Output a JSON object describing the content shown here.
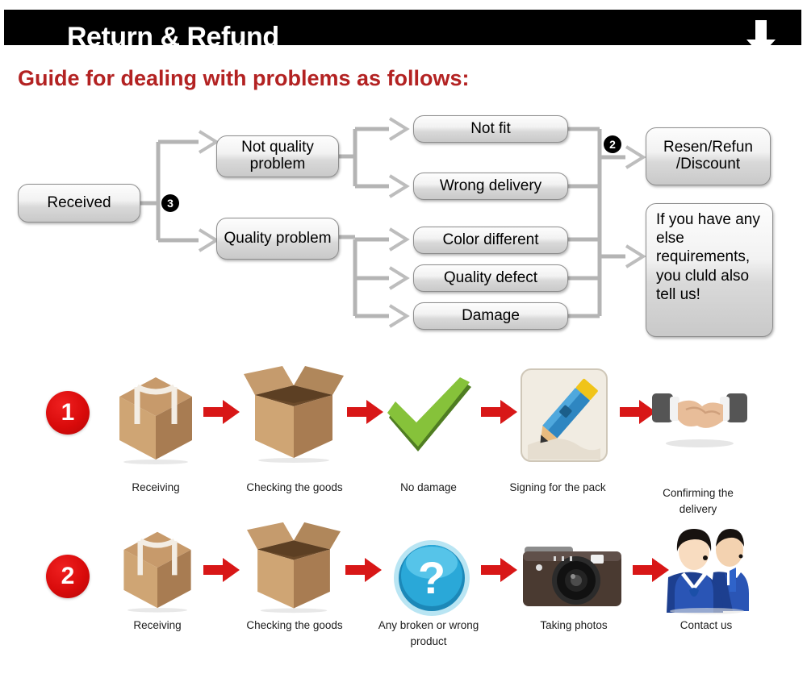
{
  "header": {
    "title": "Return & Refund",
    "arrow_icon": "down-arrow-icon",
    "background_color": "#000000",
    "text_color": "#ffffff"
  },
  "guide": {
    "title": "Guide for dealing with problems as follows:",
    "color": "#B32222"
  },
  "flowchart": {
    "boxes": [
      {
        "id": "received",
        "label": "Received"
      },
      {
        "id": "not-quality",
        "label": "Not quality problem"
      },
      {
        "id": "quality",
        "label": "Quality problem"
      },
      {
        "id": "not-fit",
        "label": "Not fit"
      },
      {
        "id": "wrong-delivery",
        "label": "Wrong delivery"
      },
      {
        "id": "color-different",
        "label": "Color different"
      },
      {
        "id": "quality-defect",
        "label": "Quality defect"
      },
      {
        "id": "damage",
        "label": "Damage"
      },
      {
        "id": "resend",
        "label": "Resen/Refun /Discount"
      },
      {
        "id": "note",
        "label": "If you have any else requirements, you cluld also tell us!"
      }
    ],
    "badges": [
      {
        "id": "badge-3",
        "label": "3"
      },
      {
        "id": "badge-2",
        "label": "2"
      }
    ]
  },
  "process_rows": [
    {
      "number": "1",
      "steps": [
        {
          "icon": "closed-box-icon",
          "label": "Receiving"
        },
        {
          "icon": "open-box-icon",
          "label": "Checking the goods"
        },
        {
          "icon": "green-check-icon",
          "label": "No damage"
        },
        {
          "icon": "pencil-sign-icon",
          "label": "Signing for the pack"
        },
        {
          "icon": "handshake-icon",
          "label": "Confirming the delivery"
        }
      ]
    },
    {
      "number": "2",
      "steps": [
        {
          "icon": "closed-box-icon",
          "label": "Receiving"
        },
        {
          "icon": "open-box-icon",
          "label": "Checking the goods"
        },
        {
          "icon": "question-mark-icon",
          "label": "Any broken or wrong product"
        },
        {
          "icon": "camera-icon",
          "label": "Taking photos"
        },
        {
          "icon": "support-agents-icon",
          "label": "Contact us"
        }
      ]
    }
  ],
  "colors": {
    "accent_red": "#D90B0B",
    "title_red": "#B32222",
    "box_border": "#8d8d8d",
    "connector": "#b4b4b4"
  }
}
